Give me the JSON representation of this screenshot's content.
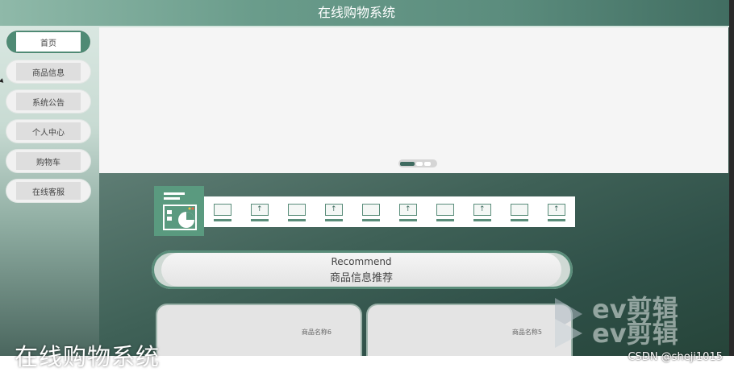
{
  "header": {
    "title": "在线购物系统"
  },
  "sidebar": {
    "items": [
      {
        "label": "首页",
        "active": true
      },
      {
        "label": "商品信息"
      },
      {
        "label": "系统公告"
      },
      {
        "label": "个人中心"
      },
      {
        "label": "购物车"
      },
      {
        "label": "在线客服"
      }
    ]
  },
  "carousel": {
    "slides": 3,
    "active_index": 0
  },
  "recommend": {
    "title_en": "Recommend",
    "title_zh": "商品信息推荐"
  },
  "products": [
    {
      "name": "商品名称6"
    },
    {
      "name": "商品名称5"
    }
  ],
  "overlay": {
    "caption": "在线购物系统",
    "credit": "CSDN @sheji1015",
    "watermark_line1": "ev剪辑",
    "watermark_line2": "ev剪辑"
  },
  "colors": {
    "accent": "#4f8a74",
    "header": "#5b8c7d"
  }
}
